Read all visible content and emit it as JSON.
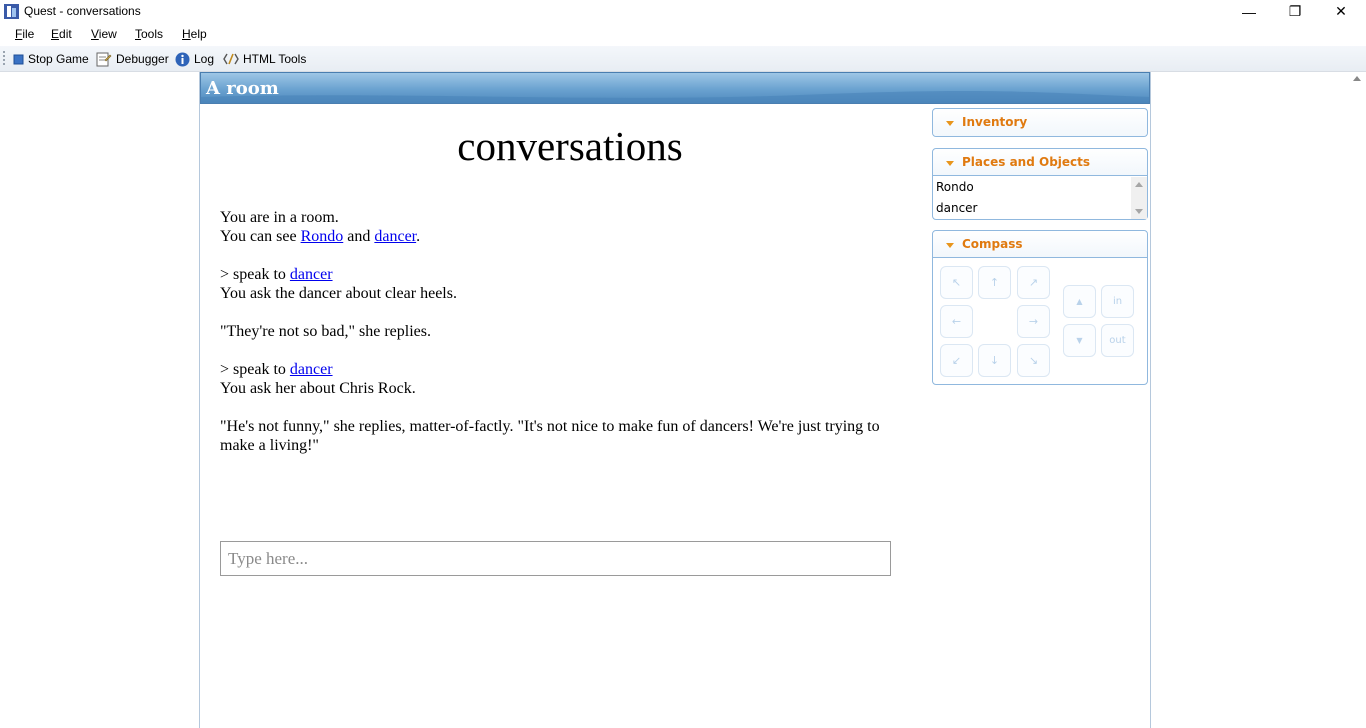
{
  "window": {
    "title": "Quest - conversations",
    "minimize_glyph": "—",
    "maximize_glyph": "❐",
    "close_glyph": "✕"
  },
  "menu": {
    "items": [
      {
        "label": "File"
      },
      {
        "label": "Edit"
      },
      {
        "label": "View"
      },
      {
        "label": "Tools"
      },
      {
        "label": "Help"
      }
    ]
  },
  "toolbar": {
    "stop_game": "Stop Game",
    "debugger": "Debugger",
    "log": "Log",
    "html_tools": "HTML Tools"
  },
  "game": {
    "room_name": "A room",
    "title": "conversations",
    "output": {
      "line1": "You are in a room.",
      "line2_prefix": "You can see ",
      "link_rondo": "Rondo",
      "line2_and": " and ",
      "link_dancer": "dancer",
      "line2_suffix": ".",
      "cmd_prefix": "> speak to ",
      "cmd1_link": "dancer",
      "response1": "You ask the dancer about clear heels.",
      "quote1": "\"They're not so bad,\" she replies.",
      "cmd2_link": "dancer",
      "response2": "You ask her about Chris Rock.",
      "quote2": "\"He's not funny,\" she replies, matter-of-factly. \"It's not nice to make fun of dancers! We're just trying to make a living!\""
    },
    "command": {
      "placeholder": "Type here...",
      "value": ""
    }
  },
  "panes": {
    "inventory": {
      "label": "Inventory"
    },
    "places": {
      "label": "Places and Objects",
      "items": [
        "Rondo",
        "dancer"
      ]
    },
    "compass": {
      "label": "Compass",
      "nw": "↖",
      "n": "↑",
      "ne": "↗",
      "w": "←",
      "e": "→",
      "sw": "↙",
      "s": "↓",
      "se": "↘",
      "up": "▲",
      "down": "▼",
      "in": "in",
      "out": "out"
    }
  },
  "colors": {
    "link": "#0000ee",
    "pane_accent": "#e07a10",
    "pane_border": "#90b8de",
    "header_blue": "#6aa2d0"
  }
}
